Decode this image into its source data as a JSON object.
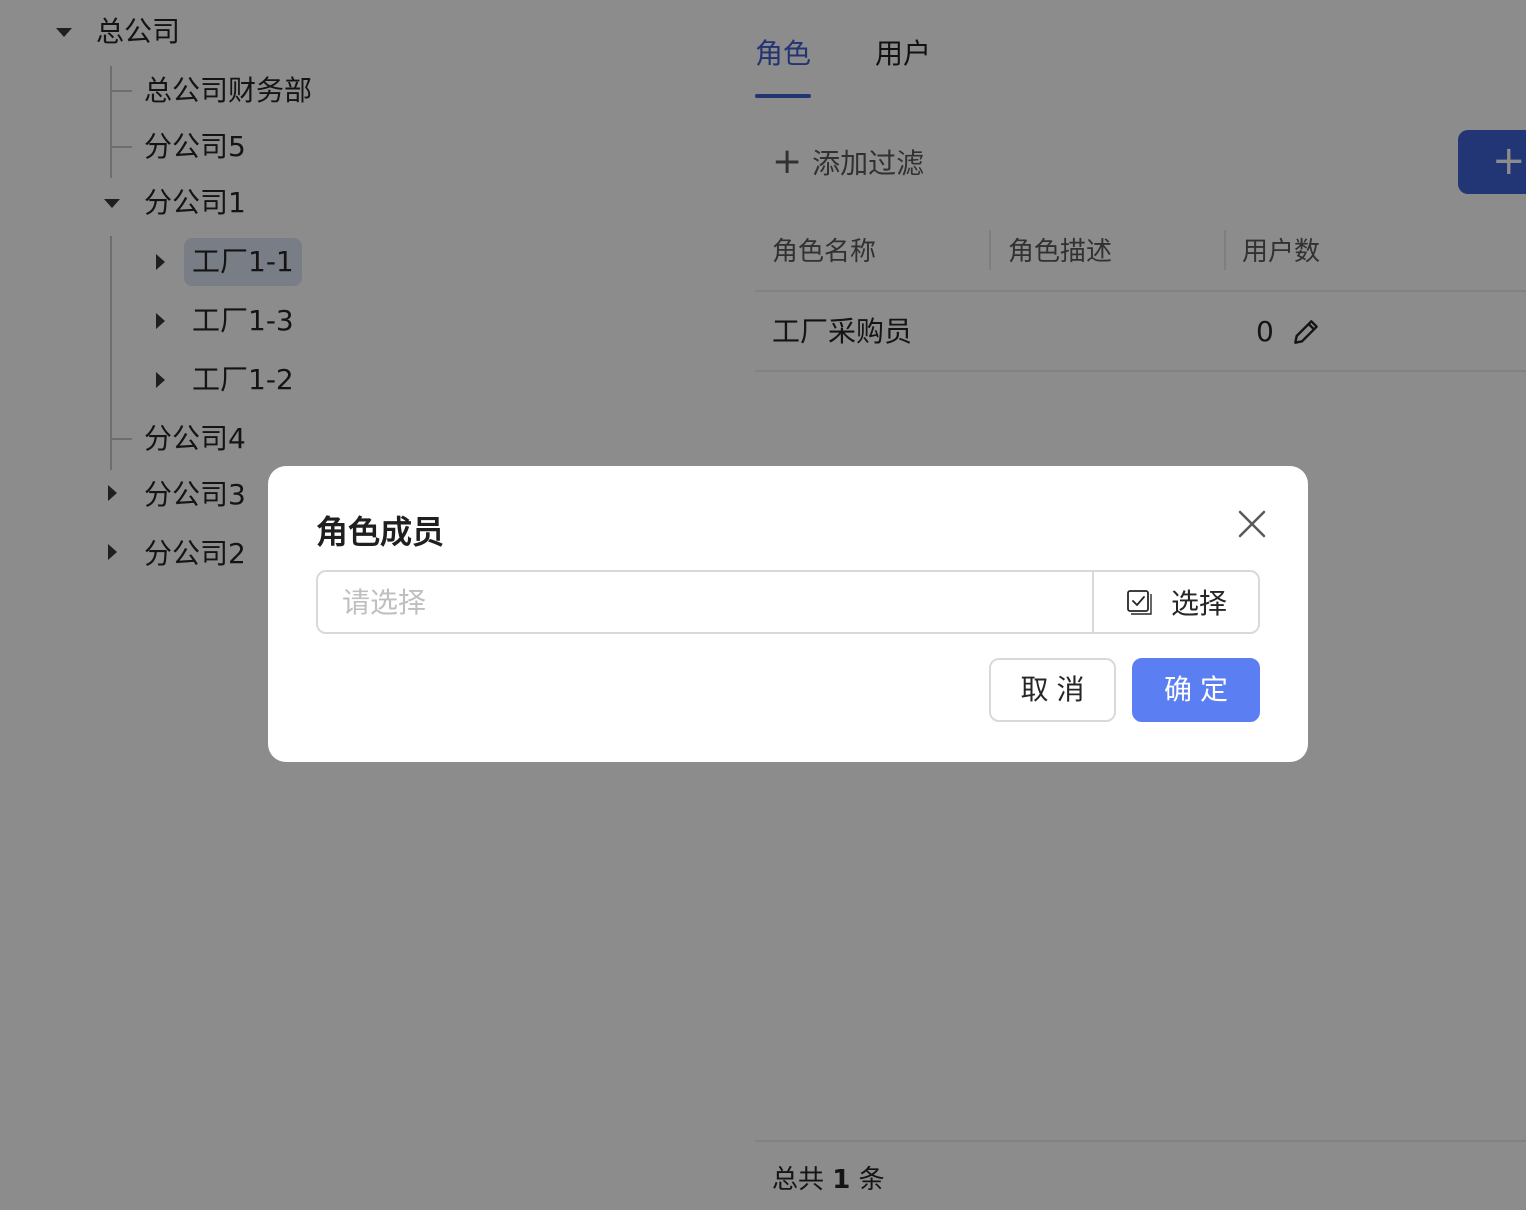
{
  "tree": {
    "root": "总公司",
    "finance": "总公司财务部",
    "branch5": "分公司5",
    "branch1": "分公司1",
    "factory_1_1": "工厂1-1",
    "factory_1_3": "工厂1-3",
    "factory_1_2": "工厂1-2",
    "branch4": "分公司4",
    "branch3": "分公司3",
    "branch2": "分公司2"
  },
  "tabs": {
    "roles": "角色",
    "users": "用户"
  },
  "toolbar": {
    "add_filter": "添加过滤",
    "add_icon": "+"
  },
  "table": {
    "headers": [
      "角色名称",
      "角色描述",
      "用户数"
    ],
    "rows": [
      {
        "name": "工厂采购员",
        "description": "",
        "user_count": "0"
      }
    ]
  },
  "footer": {
    "prefix": "总共",
    "count": "1",
    "suffix": "条"
  },
  "modal": {
    "title": "角色成员",
    "placeholder": "请选择",
    "select_label": "选择",
    "cancel": "取消",
    "ok": "确定"
  }
}
